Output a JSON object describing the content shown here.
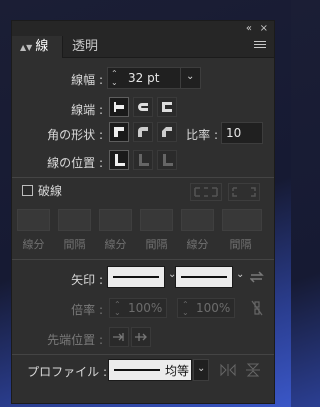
{
  "titlebar": {
    "collapse_glyph": "«",
    "close_glyph": "×"
  },
  "tabs": [
    {
      "label": "線",
      "active": true
    },
    {
      "label": "透明",
      "active": false
    }
  ],
  "weight": {
    "label": "線幅 :",
    "value": "32 pt"
  },
  "cap": {
    "label": "線端 :",
    "options": [
      "butt-cap",
      "round-cap",
      "projecting-cap"
    ],
    "selected": 0
  },
  "corner": {
    "label": "角の形状 :",
    "options": [
      "miter-join",
      "round-join",
      "bevel-join"
    ],
    "selected": 0,
    "limit_label": "比率 :",
    "limit_value": "10"
  },
  "align": {
    "label": "線の位置 :",
    "options": [
      "align-center",
      "align-inside",
      "align-outside"
    ],
    "selected": 0
  },
  "dashed": {
    "label": "破線",
    "checked": false
  },
  "dash_fields": [
    {
      "label": "線分"
    },
    {
      "label": "間隔"
    },
    {
      "label": "線分"
    },
    {
      "label": "間隔"
    },
    {
      "label": "線分"
    },
    {
      "label": "間隔"
    }
  ],
  "arrowheads": {
    "label": "矢印 :"
  },
  "scale": {
    "label": "倍率 :",
    "start": "100%",
    "end": "100%"
  },
  "arrow_align": {
    "label": "先端位置 :"
  },
  "profile": {
    "label": "プロファイル :",
    "value": "均等"
  },
  "colors": {
    "panel": "#2f2f2f",
    "field": "#202020",
    "text": "#d6d6d6"
  }
}
